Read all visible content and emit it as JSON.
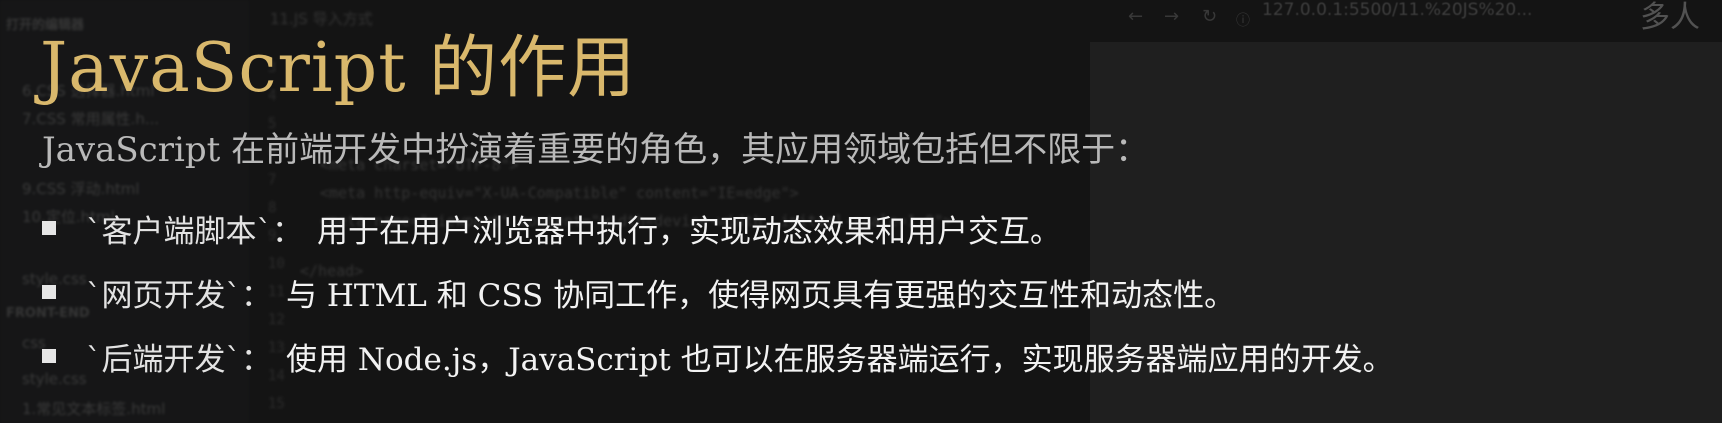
{
  "slide": {
    "title": "JavaScript 的作用",
    "intro": "JavaScript 在前端开发中扮演着重要的角色，其应用领域包括但不限于：",
    "bullets": [
      {
        "term": "`客户端脚本`：",
        "desc": "用于在用户浏览器中执行，实现动态效果和用户交互。"
      },
      {
        "term": "`网页开发`：",
        "desc": "与 HTML 和 CSS 协同工作，使得网页具有更强的交互性和动态性。"
      },
      {
        "term": "`后端开发`：",
        "desc": "使用 Node.js，JavaScript 也可以在服务器端运行，实现服务器端应用的开发。"
      }
    ]
  },
  "background": {
    "sidebar": {
      "open_editors_header": "打开的编辑器",
      "files": [
        "6.CSS 选择器.html",
        "7.CSS 常用属性.h...",
        "9.CSS 浮动.html",
        "10.定位.html",
        "style.css",
        "style.css",
        "1.常见文本标签.html"
      ],
      "folder_header": "FRONT-END",
      "folder": "css"
    },
    "editor": {
      "tab": "11.JS 导入方式",
      "line_numbers": [
        "3",
        "4",
        "5",
        "6",
        "7",
        "8",
        "9",
        "10",
        "11",
        "12",
        "13",
        "14",
        "15"
      ],
      "code_lines": [
        "<meta charset=\"UTF-8\">",
        "<meta http-equiv=\"X-UA-Compatible\" content=\"IE=edge\">",
        "<meta name=\"viewport\" content=\"width=device-width, initial-scale=1.0\">",
        "</head>"
      ]
    },
    "browser": {
      "address": "127.0.0.1:5500/11.%20JS%20...",
      "corner_text": "多人"
    }
  },
  "colors": {
    "title": "#d9b86c",
    "intro": "#b9b9b9",
    "bullet_text": "#f2f2f2",
    "background": "#1c1c1c"
  }
}
